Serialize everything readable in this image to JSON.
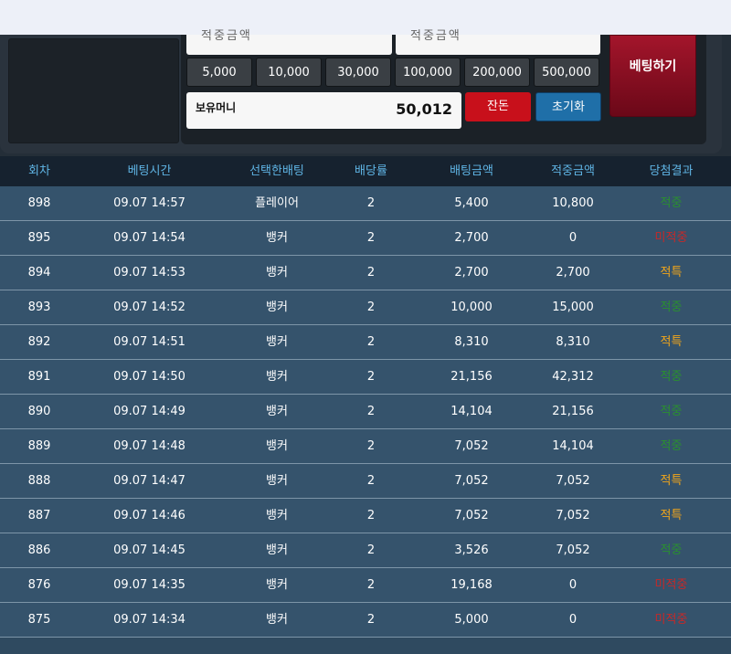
{
  "top_fields": {
    "left_partial": "적중금액",
    "right_partial": "적중금액"
  },
  "chips": [
    "5,000",
    "10,000",
    "30,000",
    "100,000",
    "200,000",
    "500,000"
  ],
  "money": {
    "label": "보유머니",
    "value": "50,012"
  },
  "buttons": {
    "balance": "잔돈",
    "reset": "초기화",
    "bet": "베팅하기"
  },
  "table": {
    "headers": [
      "회차",
      "베팅시간",
      "선택한배팅",
      "배당률",
      "배팅금액",
      "적중금액",
      "당첨결과"
    ],
    "result_colors": {
      "적중": "#2a8f2f",
      "미적중": "#c62828",
      "적특": "#f0a51a"
    },
    "rows": [
      [
        "898",
        "09.07 14:57",
        "플레이어",
        "2",
        "5,400",
        "10,800",
        "적중"
      ],
      [
        "895",
        "09.07 14:54",
        "뱅커",
        "2",
        "2,700",
        "0",
        "미적중"
      ],
      [
        "894",
        "09.07 14:53",
        "뱅커",
        "2",
        "2,700",
        "2,700",
        "적특"
      ],
      [
        "893",
        "09.07 14:52",
        "뱅커",
        "2",
        "10,000",
        "15,000",
        "적중"
      ],
      [
        "892",
        "09.07 14:51",
        "뱅커",
        "2",
        "8,310",
        "8,310",
        "적특"
      ],
      [
        "891",
        "09.07 14:50",
        "뱅커",
        "2",
        "21,156",
        "42,312",
        "적중"
      ],
      [
        "890",
        "09.07 14:49",
        "뱅커",
        "2",
        "14,104",
        "21,156",
        "적중"
      ],
      [
        "889",
        "09.07 14:48",
        "뱅커",
        "2",
        "7,052",
        "14,104",
        "적중"
      ],
      [
        "888",
        "09.07 14:47",
        "뱅커",
        "2",
        "7,052",
        "7,052",
        "적특"
      ],
      [
        "887",
        "09.07 14:46",
        "뱅커",
        "2",
        "7,052",
        "7,052",
        "적특"
      ],
      [
        "886",
        "09.07 14:45",
        "뱅커",
        "2",
        "3,526",
        "7,052",
        "적중"
      ],
      [
        "876",
        "09.07 14:35",
        "뱅커",
        "2",
        "19,168",
        "0",
        "미적중"
      ],
      [
        "875",
        "09.07 14:34",
        "뱅커",
        "2",
        "5,000",
        "0",
        "미적중"
      ]
    ]
  }
}
